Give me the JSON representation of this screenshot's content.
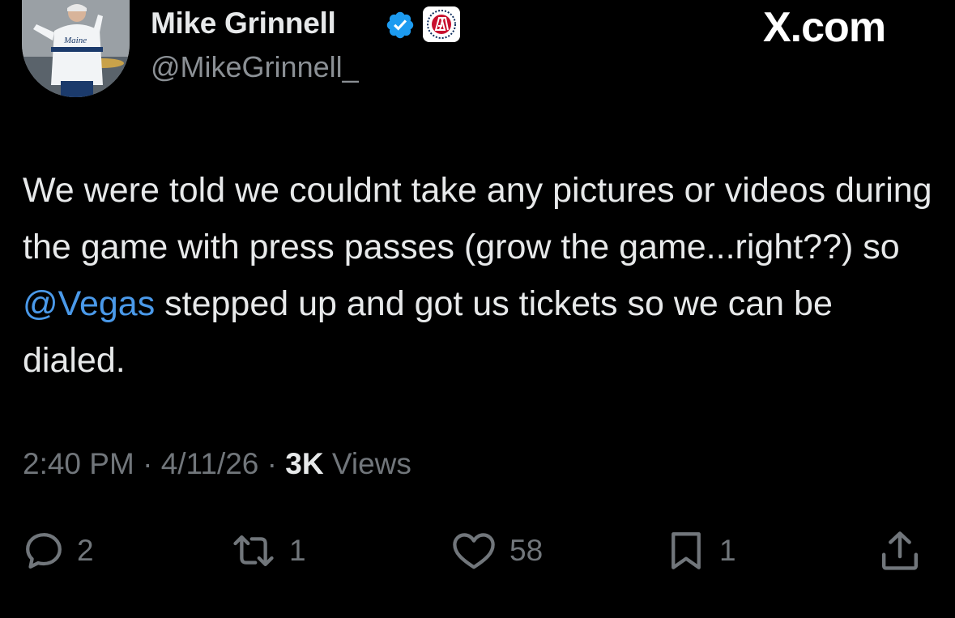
{
  "author": {
    "display_name": "Mike Grinnell",
    "handle": "@MikeGrinnell_",
    "verified_icon": "verified-badge-icon",
    "affiliation_icon": "barstool-badge-icon",
    "avatar_jersey_text": "Maine"
  },
  "brand": {
    "label": "X.com"
  },
  "tweet": {
    "text_before_mention": "We were told we couldnt take any pictures or videos during the game with press passes (grow the game...right??) so ",
    "mention": "@Vegas",
    "text_after_mention": " stepped up and got us tickets so we can be dialed."
  },
  "meta": {
    "time": "2:40 PM",
    "sep1": " · ",
    "date": "4/11/26",
    "sep2": " · ",
    "views_count": "3K",
    "views_label": " Views"
  },
  "actions": {
    "replies": "2",
    "reposts": "1",
    "likes": "58",
    "bookmarks": "1"
  },
  "colors": {
    "background": "#000000",
    "text": "#e7e9ea",
    "secondary": "#71767b",
    "link": "#4a99e9",
    "verified": "#1d9bf0"
  }
}
